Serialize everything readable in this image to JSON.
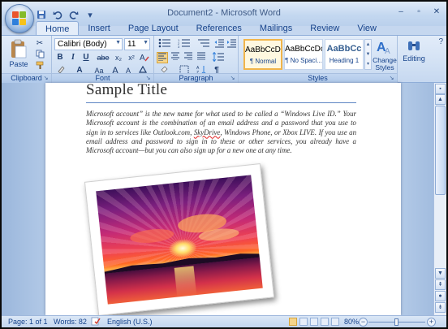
{
  "window": {
    "title": "Document2 - Microsoft Word"
  },
  "qat": [
    "save-icon",
    "undo-icon",
    "redo-icon",
    "customize-icon"
  ],
  "tabs": [
    {
      "label": "Home",
      "active": true
    },
    {
      "label": "Insert"
    },
    {
      "label": "Page Layout"
    },
    {
      "label": "References"
    },
    {
      "label": "Mailings"
    },
    {
      "label": "Review"
    },
    {
      "label": "View"
    }
  ],
  "ribbon": {
    "clipboard": {
      "label": "Clipboard",
      "paste": "Paste"
    },
    "font": {
      "label": "Font",
      "name": "Calibri (Body)",
      "size": "11",
      "bold": "B",
      "italic": "I",
      "underline": "U",
      "strike": "abe",
      "sub": "x₂",
      "sup": "x²",
      "clear": "Aa",
      "grow": "A",
      "shrink": "A",
      "color": "A"
    },
    "paragraph": {
      "label": "Paragraph",
      "pilcrow": "¶"
    },
    "styles": {
      "label": "Styles",
      "items": [
        {
          "preview": "AaBbCcDc",
          "name": "¶ Normal"
        },
        {
          "preview": "AaBbCcDc",
          "name": "¶ No Spaci..."
        },
        {
          "preview": "AaBbCc",
          "name": "Heading 1"
        }
      ],
      "change": "Change Styles"
    },
    "editing": {
      "label": "Editing"
    }
  },
  "document": {
    "title": "Sample Title",
    "body_pre": "Microsoft account” is the new name for what used to be called a “Windows Live ID.” Your Microsoft account is the combination of an email address and a password that you use to sign in to services like Outlook.com, ",
    "body_flag": "SkyDrive",
    "body_post": ", Windows Phone, or Xbox LIVE. If you use an email address and password to sign in to these or other services, you already have a Microsoft account—but you can also sign up for a new one at any time."
  },
  "status": {
    "page": "Page: 1 of 1",
    "words": "Words: 82",
    "language": "English (U.S.)",
    "zoom": "80%",
    "zoom_value": 80
  },
  "colors": {
    "accent": "#15428b",
    "ribbon": "#d2e1f4",
    "rule": "#5e86c4"
  }
}
